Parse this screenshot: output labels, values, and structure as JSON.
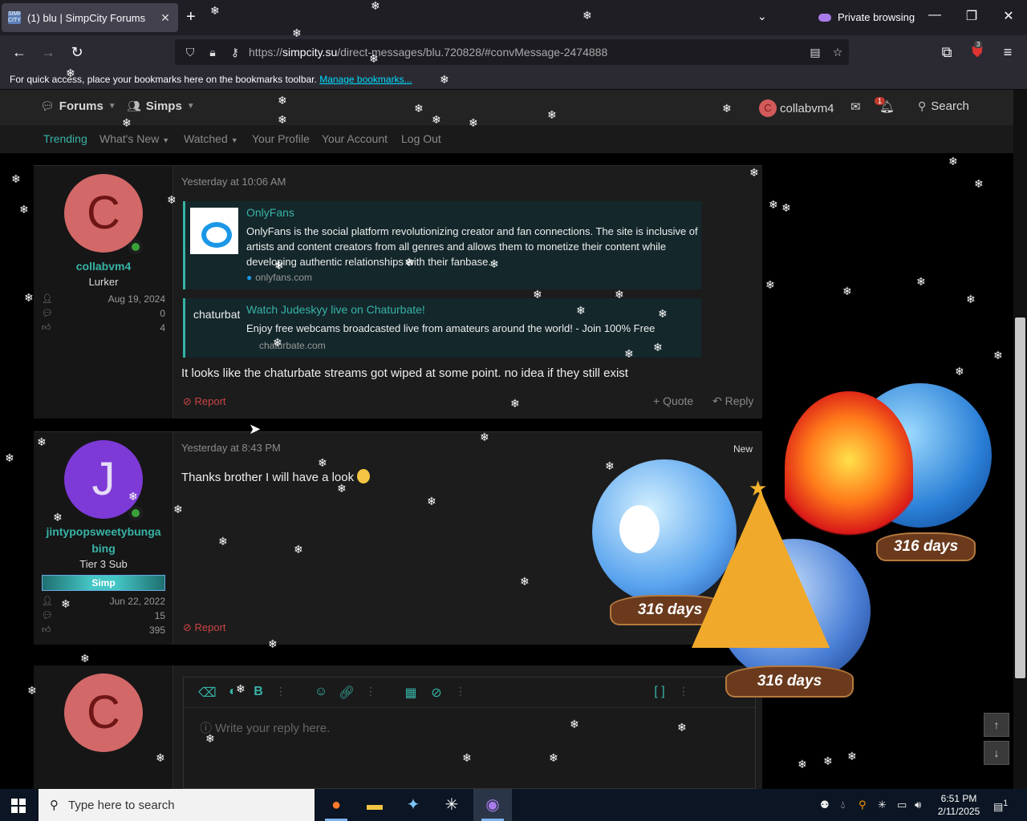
{
  "browser": {
    "tab_title": "(1) blu | SimpCity Forums",
    "favicon_text": "SIMP CITY",
    "new_tab": "+",
    "private_label": "Private browsing",
    "url_scheme": "https://",
    "url_host": "simpcity.su",
    "url_path": "/direct-messages/blu.720828/#convMessage-2474888",
    "extension_badge": "3",
    "bookmarks_text": "For quick access, place your bookmarks here on the bookmarks toolbar.",
    "bookmarks_link": "Manage bookmarks..."
  },
  "site_nav": {
    "forums": "Forums",
    "simps": "Simps",
    "username": "collabvm4",
    "avatar_letter": "C",
    "alert_count": "1",
    "search": "Search"
  },
  "sub_nav": [
    "Trending",
    "What's New",
    "Watched",
    "Your Profile",
    "Your Account",
    "Log Out"
  ],
  "messages": [
    {
      "avatar_letter": "C",
      "username": "collabvm4",
      "user_title": "Lurker",
      "joined": "Aug 19, 2024",
      "messages": "0",
      "reactions": "4",
      "date": "Yesterday at 10:06 AM",
      "embeds": [
        {
          "title": "OnlyFans",
          "desc_line1": "OnlyFans is the social platform revolutionizing creator and fan connections. The site is inclusive of",
          "desc_line2": "artists and content creators from all genres and allows them to monetize their content while",
          "desc_line3": "developing authentic relationships with their fanbase.",
          "site": "onlyfans.com"
        },
        {
          "thumb_text": "chaturbate",
          "title": "Watch Judeskyy live on Chaturbate!",
          "desc_line1": "Enjoy free webcams broadcasted live from amateurs around the world! - Join 100% Free",
          "site": "chaturbate.com"
        }
      ],
      "text": "It looks like the chaturbate streams got wiped at some point. no idea if they still exist",
      "report": "Report",
      "quote": "Quote",
      "reply": "Reply"
    },
    {
      "avatar_letter": "J",
      "username_line1": "jintypopsweetybunga",
      "username_line2": "bing",
      "user_title": "Tier 3 Sub",
      "banner": "Simp",
      "joined": "Jun 22, 2022",
      "messages": "15",
      "reactions": "395",
      "date": "Yesterday at 8:43 PM",
      "new_label": "New",
      "text": "Thanks brother I will have a look",
      "report": "Report"
    }
  ],
  "editor": {
    "avatar_letter": "C",
    "placeholder": "Write your reply here."
  },
  "decor": {
    "globe_days_1": "316 days",
    "globe_days_2": "316 days",
    "globe_days_3": "316 days"
  },
  "taskbar": {
    "search_placeholder": "Type here to search",
    "time": "6:51 PM",
    "date": "2/11/2025",
    "notif_count": "1"
  },
  "colors": {
    "accent": "#37b3a6",
    "report": "#cc4444",
    "browser_bg": "#2b2a33"
  }
}
